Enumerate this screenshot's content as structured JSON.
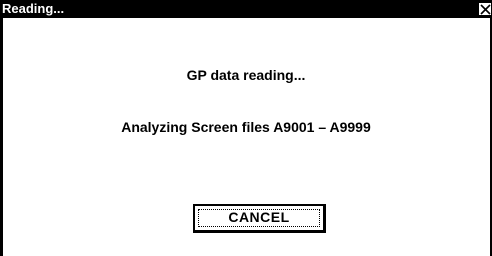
{
  "dialog": {
    "title": "Reading...",
    "close_icon": "close-x-icon",
    "message": "GP data reading...",
    "status": "Analyzing Screen files A9001 – A9999",
    "cancel_label": "CANCEL"
  },
  "colors": {
    "titlebar": "#000000",
    "title_text": "#ffffff",
    "background": "#ffffff",
    "text": "#000000"
  }
}
